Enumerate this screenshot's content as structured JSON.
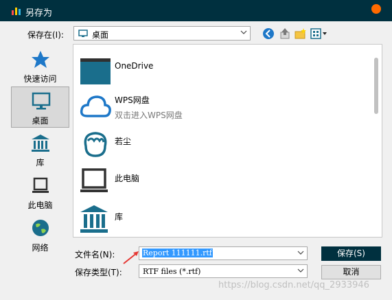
{
  "window": {
    "title": "另存为"
  },
  "lookin": {
    "label": "保存在(I):",
    "value": "桌面"
  },
  "toolbar": {
    "icons": [
      "back-icon",
      "up-folder-icon",
      "new-folder-icon",
      "view-menu-icon"
    ]
  },
  "places": [
    {
      "label": "快速访问",
      "icon": "star-icon"
    },
    {
      "label": "桌面",
      "icon": "monitor-icon",
      "selected": true
    },
    {
      "label": "库",
      "icon": "library-icon"
    },
    {
      "label": "此电脑",
      "icon": "laptop-icon"
    },
    {
      "label": "网络",
      "icon": "globe-icon"
    }
  ],
  "files": [
    {
      "name": "OneDrive",
      "icon": "folder-icon"
    },
    {
      "name": "WPS网盘",
      "sub": "双击进入WPS网盘",
      "icon": "cloud-icon"
    },
    {
      "name": "若尘",
      "icon": "user-icon"
    },
    {
      "name": "此电脑",
      "icon": "laptop-icon"
    },
    {
      "name": "库",
      "icon": "library-icon"
    }
  ],
  "filename": {
    "label": "文件名(N):",
    "value": "Report 111111.rtf"
  },
  "filetype": {
    "label": "保存类型(T):",
    "value": "RTF files (*.rtf)"
  },
  "buttons": {
    "save": "保存(S)",
    "cancel": "取消"
  },
  "watermark": "https://blog.csdn.net/qq_2933946",
  "colors": {
    "titlebar": "#00303f",
    "accent": "#1a6e8c",
    "close": "#ff6a00",
    "selection": "#3399ff"
  }
}
